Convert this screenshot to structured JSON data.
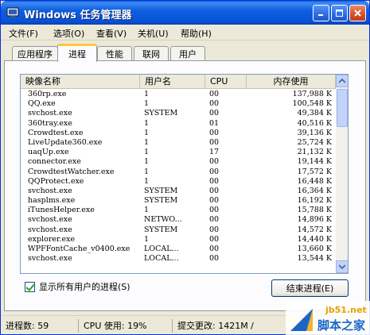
{
  "window": {
    "title": "Windows 任务管理器",
    "colors": {
      "titlebar": "#0851d6",
      "tab_highlight": "#ffc83c",
      "checkbox": "#21a121"
    }
  },
  "menu": [
    "文件(F)",
    "选项(O)",
    "查看(V)",
    "关机(U)",
    "帮助(H)"
  ],
  "tabs": [
    "应用程序",
    "进程",
    "性能",
    "联网",
    "用户"
  ],
  "active_tab": "进程",
  "columns": [
    "映像名称",
    "用户名",
    "CPU",
    "内存使用"
  ],
  "processes": [
    {
      "name": "360rp.exe",
      "user": "1",
      "cpu": "00",
      "mem": "137,988 K"
    },
    {
      "name": "QQ.exe",
      "user": "1",
      "cpu": "00",
      "mem": "100,548 K"
    },
    {
      "name": "svchost.exe",
      "user": "SYSTEM",
      "cpu": "00",
      "mem": "49,384 K"
    },
    {
      "name": "360tray.exe",
      "user": "1",
      "cpu": "01",
      "mem": "40,516 K"
    },
    {
      "name": "Crowdtest.exe",
      "user": "1",
      "cpu": "00",
      "mem": "39,136 K"
    },
    {
      "name": "LiveUpdate360.exe",
      "user": "1",
      "cpu": "00",
      "mem": "25,724 K"
    },
    {
      "name": "uaqUp.exe",
      "user": "1",
      "cpu": "17",
      "mem": "21,132 K"
    },
    {
      "name": "connector.exe",
      "user": "1",
      "cpu": "00",
      "mem": "19,144 K"
    },
    {
      "name": "CrowdtestWatcher.exe",
      "user": "1",
      "cpu": "00",
      "mem": "17,572 K"
    },
    {
      "name": "QQProtect.exe",
      "user": "1",
      "cpu": "00",
      "mem": "16,448 K"
    },
    {
      "name": "svchost.exe",
      "user": "SYSTEM",
      "cpu": "00",
      "mem": "16,364 K"
    },
    {
      "name": "hasplms.exe",
      "user": "SYSTEM",
      "cpu": "00",
      "mem": "16,192 K"
    },
    {
      "name": "iTunesHelper.exe",
      "user": "1",
      "cpu": "00",
      "mem": "15,788 K"
    },
    {
      "name": "svchost.exe",
      "user": "NETWO...",
      "cpu": "00",
      "mem": "14,896 K"
    },
    {
      "name": "svchost.exe",
      "user": "SYSTEM",
      "cpu": "00",
      "mem": "14,572 K"
    },
    {
      "name": "explorer.exe",
      "user": "1",
      "cpu": "00",
      "mem": "14,440 K"
    },
    {
      "name": "WPFFontCache_v0400.exe",
      "user": "LOCAL...",
      "cpu": "00",
      "mem": "13,660 K"
    },
    {
      "name": "svchost.exe",
      "user": "LOCAL...",
      "cpu": "00",
      "mem": "13,544 K"
    }
  ],
  "show_all_label": "显示所有用户的进程(S)",
  "show_all_checked": true,
  "end_process_label": "结束进程(E)",
  "status": {
    "processes": "进程数: 59",
    "cpu": "CPU 使用: 19%",
    "commit": "提交更改: 1421M /"
  },
  "watermark": {
    "top": "jb51.net",
    "bottom": "脚本之家"
  }
}
